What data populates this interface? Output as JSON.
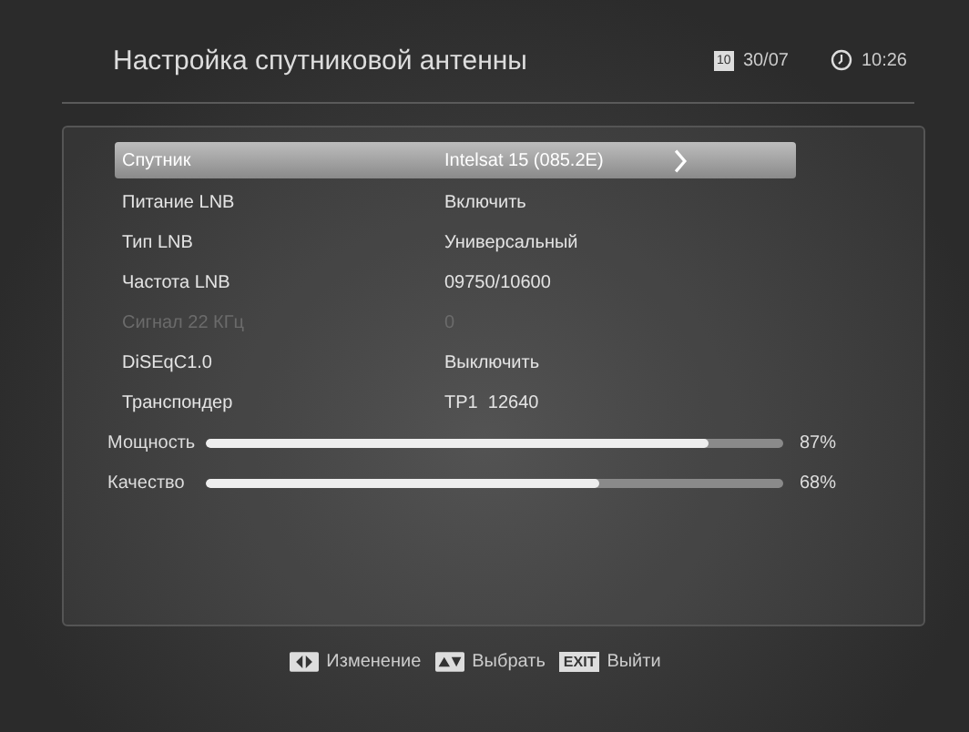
{
  "header": {
    "title": "Настройка спутниковой антенны",
    "date": "30/07",
    "calendar_day": "10",
    "time": "10:26"
  },
  "settings": [
    {
      "label": "Спутник",
      "value": "Intelsat 15 (085.2E)",
      "selected": true,
      "disabled": false
    },
    {
      "label": "Питание LNB",
      "value": "Включить",
      "selected": false,
      "disabled": false
    },
    {
      "label": "Тип LNB",
      "value": "Универсальный",
      "selected": false,
      "disabled": false
    },
    {
      "label": "Частота LNB",
      "value": "09750/10600",
      "selected": false,
      "disabled": false
    },
    {
      "label": "Сигнал 22 КГц",
      "value": "0",
      "selected": false,
      "disabled": true
    },
    {
      "label": "DiSEqC1.0",
      "value": "Выключить",
      "selected": false,
      "disabled": false
    },
    {
      "label": "Транспондер",
      "value": "TP1  12640",
      "selected": false,
      "disabled": false
    }
  ],
  "meters": [
    {
      "label": "Мощность",
      "level": 0.87,
      "reading": "87%"
    },
    {
      "label": "Качество",
      "level": 0.68,
      "reading": "68%"
    }
  ],
  "hints": [
    {
      "kind": "left-right",
      "label": "Изменение"
    },
    {
      "kind": "up-down",
      "label": "Выбрать"
    },
    {
      "kind": "key",
      "key": "EXIT",
      "label": "Выйти"
    }
  ]
}
